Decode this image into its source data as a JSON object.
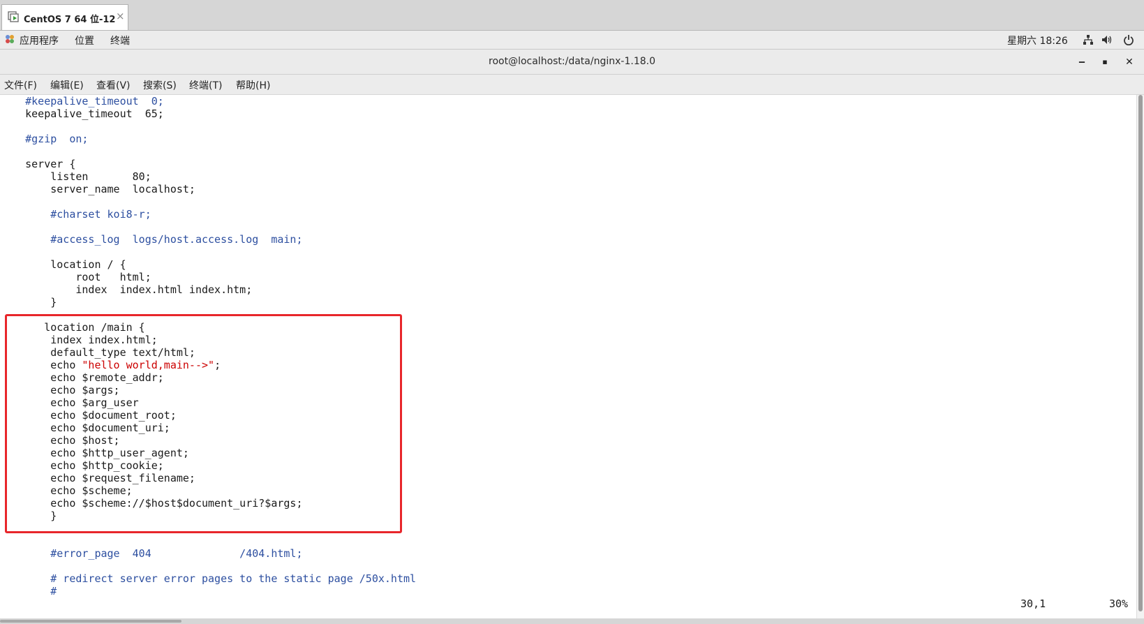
{
  "vm_tab": {
    "title": "CentOS 7 64 位-12",
    "close": "×"
  },
  "topbar": {
    "applications": "应用程序",
    "places": "位置",
    "terminal": "终端",
    "clock": "星期六 18:26"
  },
  "window": {
    "title": "root@localhost:/data/nginx-1.18.0",
    "minimize": "‒",
    "maximize": "▪",
    "close": "✕"
  },
  "menubar": {
    "file": "文件(F)",
    "edit": "编辑(E)",
    "view": "查看(V)",
    "search": "搜索(S)",
    "terminal": "终端(T)",
    "help": "帮助(H)"
  },
  "editor": {
    "lines": [
      {
        "text": "    #keepalive_timeout  0;",
        "style": "blue"
      },
      {
        "text": "    keepalive_timeout  65;",
        "style": "plain"
      },
      {
        "text": "",
        "style": "plain"
      },
      {
        "text": "    #gzip  on;",
        "style": "blue"
      },
      {
        "text": "",
        "style": "plain"
      },
      {
        "text": "    server {",
        "style": "plain"
      },
      {
        "text": "        listen       80;",
        "style": "plain"
      },
      {
        "text": "        server_name  localhost;",
        "style": "plain"
      },
      {
        "text": "",
        "style": "plain"
      },
      {
        "text": "        #charset koi8-r;",
        "style": "blue"
      },
      {
        "text": "",
        "style": "plain"
      },
      {
        "text": "        #access_log  logs/host.access.log  main;",
        "style": "blue"
      },
      {
        "text": "",
        "style": "plain"
      },
      {
        "text": "        location / {",
        "style": "plain"
      },
      {
        "text": "            root   html;",
        "style": "plain"
      },
      {
        "text": "            index  index.html index.htm;",
        "style": "plain"
      },
      {
        "text": "        }",
        "style": "plain"
      },
      {
        "text": "",
        "style": "plain"
      },
      {
        "text": "       location /main {",
        "style": "plain"
      },
      {
        "text": "        index index.html;",
        "style": "plain"
      },
      {
        "text": "        default_type text/html;",
        "style": "plain"
      },
      {
        "text": "        echo ",
        "style": "plain",
        "red": "\"hello world,main-->\"",
        "tail": ";"
      },
      {
        "text": "        echo $remote_addr;",
        "style": "plain"
      },
      {
        "text": "        echo $args;",
        "style": "plain"
      },
      {
        "text": "        echo $arg_user",
        "style": "plain"
      },
      {
        "text": "        echo $document_root;",
        "style": "plain"
      },
      {
        "text": "        echo $document_uri;",
        "style": "plain"
      },
      {
        "text": "        echo $host;",
        "style": "plain"
      },
      {
        "text": "        echo $http_user_agent;",
        "style": "plain"
      },
      {
        "text": "        echo $http_cookie;",
        "style": "plain"
      },
      {
        "text": "        echo $request_filename;",
        "style": "plain"
      },
      {
        "text": "        echo $scheme;",
        "style": "plain"
      },
      {
        "text": "        echo $scheme://$host$document_uri?$args;",
        "style": "plain"
      },
      {
        "text": "        }",
        "style": "plain"
      },
      {
        "text": "",
        "style": "plain"
      },
      {
        "text": "",
        "style": "plain"
      },
      {
        "text": "        #error_page  404              /404.html;",
        "style": "blue"
      },
      {
        "text": "",
        "style": "plain"
      },
      {
        "text": "        # redirect server error pages to the static page /50x.html",
        "style": "blue"
      },
      {
        "text": "        #",
        "style": "blue"
      }
    ],
    "cursor_position": "30,1",
    "scroll_percent": "30%"
  },
  "colors": {
    "comment": "#2d4fa0",
    "string": "#cc0000",
    "highlight_box": "#e8262b"
  }
}
